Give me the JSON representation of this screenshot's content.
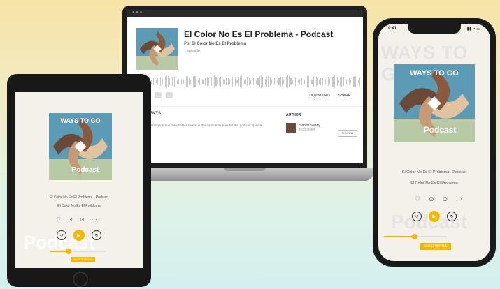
{
  "podcast": {
    "title": "El Color No Es El Problema - Podcast",
    "subtitle": "El Color No Es El Problema"
  },
  "cover_art": {
    "badge_text": "WAYS TO GO",
    "brand_text": "Podcast"
  },
  "laptop": {
    "window_title": "El Color No Es El Problema - Podcast",
    "subtitle_prefix": "Por",
    "subtitle": "El Color No Es El Problema",
    "meta": "1 episodio",
    "actions": {
      "download": "DOWNLOAD",
      "share": "SHARE"
    },
    "comments_heading": "COMMENTS",
    "description": "Episode description text placeholder shown under comments area for this podcast episode content.",
    "author_heading": "AUTHOR",
    "author_name": "Sandy Sandy",
    "author_role": "Podcaster",
    "follow_label": "FOLLOW"
  },
  "tablet": {
    "title": "El Color No Es El Problema - Podcast",
    "subtitle": "El Color No Es El Problema",
    "watermark": "Podcast",
    "button": "SUSCRIBIRSE"
  },
  "phone": {
    "title": "El Color No Es El Problema - Podcast",
    "subtitle": "El Color No Es El Problema",
    "watermark": "Podcast",
    "button": "SUSCRIBIRSE"
  },
  "playback": {
    "progress_fraction_tablet": 0.3,
    "progress_fraction_phone": 0.5
  },
  "colors": {
    "accent": "#f5b800",
    "bg_top": "#f6e3a6",
    "bg_bottom": "#d3f0ef"
  }
}
